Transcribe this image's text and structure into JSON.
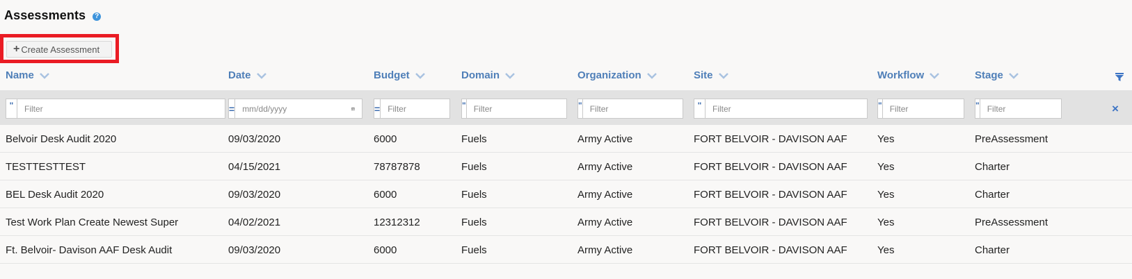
{
  "page": {
    "title": "Assessments",
    "help_icon": "?",
    "create_button_label": "Create Assessment",
    "create_button_icon": "+"
  },
  "colors": {
    "header_text": "#4f7fb8",
    "highlight_border": "#ea1c24",
    "filter_band": "#e2e2e2",
    "accent": "#3d74c4"
  },
  "columns": [
    {
      "key": "name",
      "label": "Name"
    },
    {
      "key": "date",
      "label": "Date"
    },
    {
      "key": "budget",
      "label": "Budget"
    },
    {
      "key": "domain",
      "label": "Domain"
    },
    {
      "key": "organization",
      "label": "Organization"
    },
    {
      "key": "site",
      "label": "Site"
    },
    {
      "key": "workflow",
      "label": "Workflow"
    },
    {
      "key": "stage",
      "label": "Stage"
    }
  ],
  "filters": [
    {
      "column": "name",
      "operator": "\"",
      "placeholder": "Filter"
    },
    {
      "column": "date",
      "operator": "=",
      "placeholder": "mm/dd/yyyy"
    },
    {
      "column": "budget",
      "operator": "=",
      "placeholder": "Filter"
    },
    {
      "column": "domain",
      "operator": "\"",
      "placeholder": "Filter"
    },
    {
      "column": "organization",
      "operator": "\"",
      "placeholder": "Filter"
    },
    {
      "column": "site",
      "operator": "\"",
      "placeholder": "Filter"
    },
    {
      "column": "workflow",
      "operator": "\"",
      "placeholder": "Filter"
    },
    {
      "column": "stage",
      "operator": "\"",
      "placeholder": "Filter"
    }
  ],
  "toolbar_icons": {
    "filter_toggle": "funnel-icon",
    "clear_filters": "×"
  },
  "rows": [
    {
      "name": "Belvoir Desk Audit 2020",
      "date": "09/03/2020",
      "budget": "6000",
      "domain": "Fuels",
      "organization": "Army Active",
      "site": "FORT BELVOIR - DAVISON AAF",
      "workflow": "Yes",
      "stage": "PreAssessment"
    },
    {
      "name": "TESTTESTTEST",
      "date": "04/15/2021",
      "budget": "78787878",
      "domain": "Fuels",
      "organization": "Army Active",
      "site": "FORT BELVOIR - DAVISON AAF",
      "workflow": "Yes",
      "stage": "Charter"
    },
    {
      "name": "BEL Desk Audit 2020",
      "date": "09/03/2020",
      "budget": "6000",
      "domain": "Fuels",
      "organization": "Army Active",
      "site": "FORT BELVOIR - DAVISON AAF",
      "workflow": "Yes",
      "stage": "Charter"
    },
    {
      "name": "Test Work Plan Create Newest Super",
      "date": "04/02/2021",
      "budget": "12312312",
      "domain": "Fuels",
      "organization": "Army Active",
      "site": "FORT BELVOIR - DAVISON AAF",
      "workflow": "Yes",
      "stage": "PreAssessment"
    },
    {
      "name": "Ft. Belvoir- Davison AAF Desk Audit",
      "date": "09/03/2020",
      "budget": "6000",
      "domain": "Fuels",
      "organization": "Army Active",
      "site": "FORT BELVOIR - DAVISON AAF",
      "workflow": "Yes",
      "stage": "Charter"
    }
  ]
}
